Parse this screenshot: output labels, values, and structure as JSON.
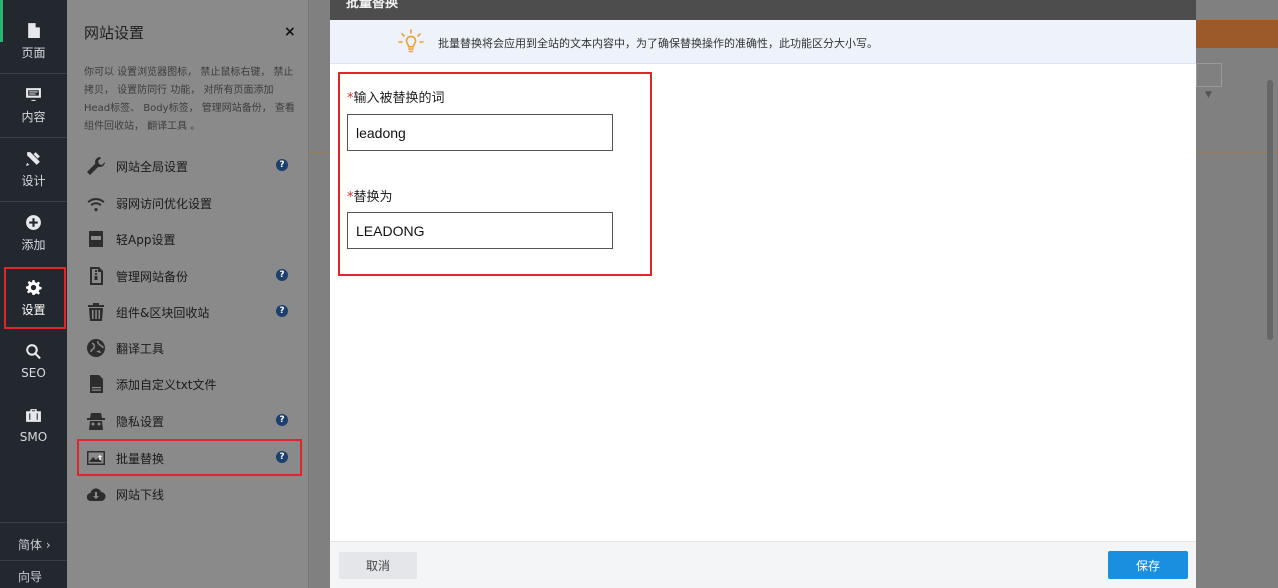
{
  "leftnav": {
    "items": [
      {
        "label": "页面",
        "icon": "page-icon"
      },
      {
        "label": "内容",
        "icon": "monitor-icon"
      },
      {
        "label": "设计",
        "icon": "design-tools-icon"
      },
      {
        "label": "添加",
        "icon": "plus-circle-icon"
      },
      {
        "label": "设置",
        "icon": "gear-icon"
      },
      {
        "label": "SEO",
        "icon": "search-icon"
      },
      {
        "label": "SMO",
        "icon": "briefcase-icon"
      }
    ],
    "language": "简体 ›",
    "guide": "向导",
    "accent_color": "#2bb673"
  },
  "panel": {
    "title": "网站设置",
    "close": "×",
    "description": "你可以 设置浏览器图标， 禁止鼠标右键， 禁止拷贝， 设置防同行 功能， 对所有页面添加 Head标签、 Body标签， 管理网站备份， 查看 组件回收站， 翻译工具 。",
    "help_mark": "?",
    "items": [
      {
        "label": "网站全局设置",
        "icon": "wrench-icon",
        "help": true
      },
      {
        "label": "弱网访问优化设置",
        "icon": "wifi-icon",
        "help": false
      },
      {
        "label": "轻App设置",
        "icon": "app-icon",
        "help": false
      },
      {
        "label": "管理网站备份",
        "icon": "zip-file-icon",
        "help": true
      },
      {
        "label": "组件&区块回收站",
        "icon": "trash-icon",
        "help": true
      },
      {
        "label": "翻译工具",
        "icon": "globe-icon",
        "help": false
      },
      {
        "label": "添加自定义txt文件",
        "icon": "txt-file-icon",
        "help": false
      },
      {
        "label": "隐私设置",
        "icon": "spy-icon",
        "help": true
      },
      {
        "label": "批量替换",
        "icon": "image-replace-icon",
        "help": true
      },
      {
        "label": "网站下线",
        "icon": "cloud-download-icon",
        "help": false
      }
    ]
  },
  "modal": {
    "title": "批量替换",
    "notice": "批量替换将会应用到全站的文本内容中，为了确保替换操作的准确性，此功能区分大小写。",
    "find_label": "输入被替换的词",
    "find_value": "leadong",
    "replace_label": "替换为",
    "replace_value": "LEADONG",
    "required_mark": "*",
    "cancel": "取消",
    "save": "保存",
    "primary_color": "#1a8fe0",
    "highlight_color": "#e0262b"
  }
}
